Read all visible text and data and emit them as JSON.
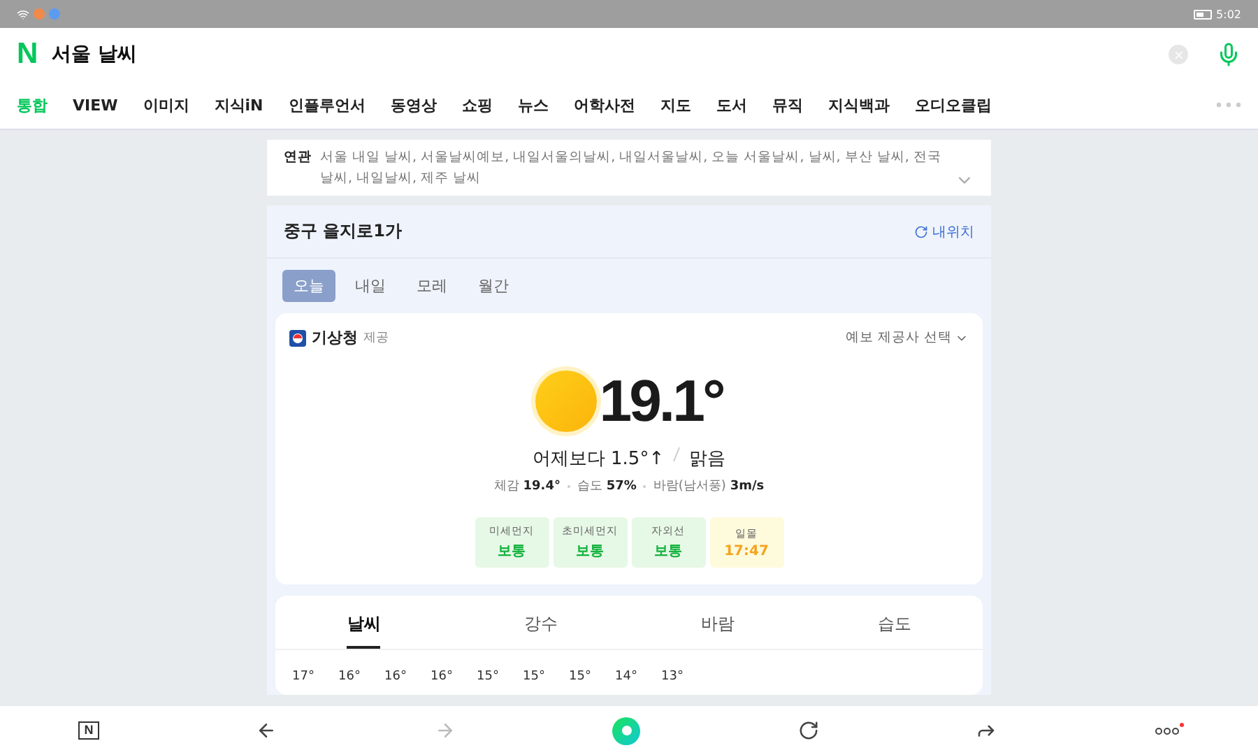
{
  "status_bar": {
    "time": "5:02"
  },
  "search": {
    "logo": "N",
    "query": "서울 날씨"
  },
  "nav_tabs": [
    {
      "label": "통합",
      "selected": true
    },
    {
      "label": "VIEW",
      "selected": false
    },
    {
      "label": "이미지",
      "selected": false
    },
    {
      "label": "지식iN",
      "selected": false
    },
    {
      "label": "인플루언서",
      "selected": false
    },
    {
      "label": "동영상",
      "selected": false
    },
    {
      "label": "쇼핑",
      "selected": false
    },
    {
      "label": "뉴스",
      "selected": false
    },
    {
      "label": "어학사전",
      "selected": false
    },
    {
      "label": "지도",
      "selected": false
    },
    {
      "label": "도서",
      "selected": false
    },
    {
      "label": "뮤직",
      "selected": false
    },
    {
      "label": "지식백과",
      "selected": false
    },
    {
      "label": "오디오클립",
      "selected": false
    }
  ],
  "related": {
    "label": "연관",
    "text": "서울 내일 날씨, 서울날씨예보, 내일서울의날씨, 내일서울날씨, 오늘 서울날씨, 날씨, 부산 날씨, 전국날씨, 내일날씨, 제주 날씨"
  },
  "weather": {
    "location": "중구 을지로1가",
    "my_location": "내위치",
    "day_tabs": [
      {
        "label": "오늘",
        "selected": true
      },
      {
        "label": "내일",
        "selected": false
      },
      {
        "label": "모레",
        "selected": false
      },
      {
        "label": "월간",
        "selected": false
      }
    ],
    "provider": "기상청",
    "provider_suffix": "제공",
    "provider_select": "예보 제공사 선택",
    "temperature": "19.1°",
    "compare": "어제보다 1.5°↑",
    "condition": "맑음",
    "details": [
      {
        "label": "체감",
        "value": "19.4°"
      },
      {
        "label": "습도",
        "value": "57%"
      },
      {
        "label": "바람(남서풍)",
        "value": "3m/s"
      }
    ],
    "indicators": [
      {
        "label": "미세먼지",
        "value": "보통",
        "kind": "status"
      },
      {
        "label": "초미세먼지",
        "value": "보통",
        "kind": "status"
      },
      {
        "label": "자외선",
        "value": "보통",
        "kind": "status"
      },
      {
        "label": "일몰",
        "value": "17:47",
        "kind": "time"
      }
    ],
    "chart_tabs": [
      {
        "label": "날씨",
        "selected": true
      },
      {
        "label": "강수",
        "selected": false
      },
      {
        "label": "바람",
        "selected": false
      },
      {
        "label": "습도",
        "selected": false
      }
    ],
    "hourly_temps": [
      "17°",
      "16°",
      "16°",
      "16°",
      "15°",
      "15°",
      "15°",
      "14°",
      "13°"
    ]
  },
  "bottom_nav": {
    "logo": "N"
  }
}
